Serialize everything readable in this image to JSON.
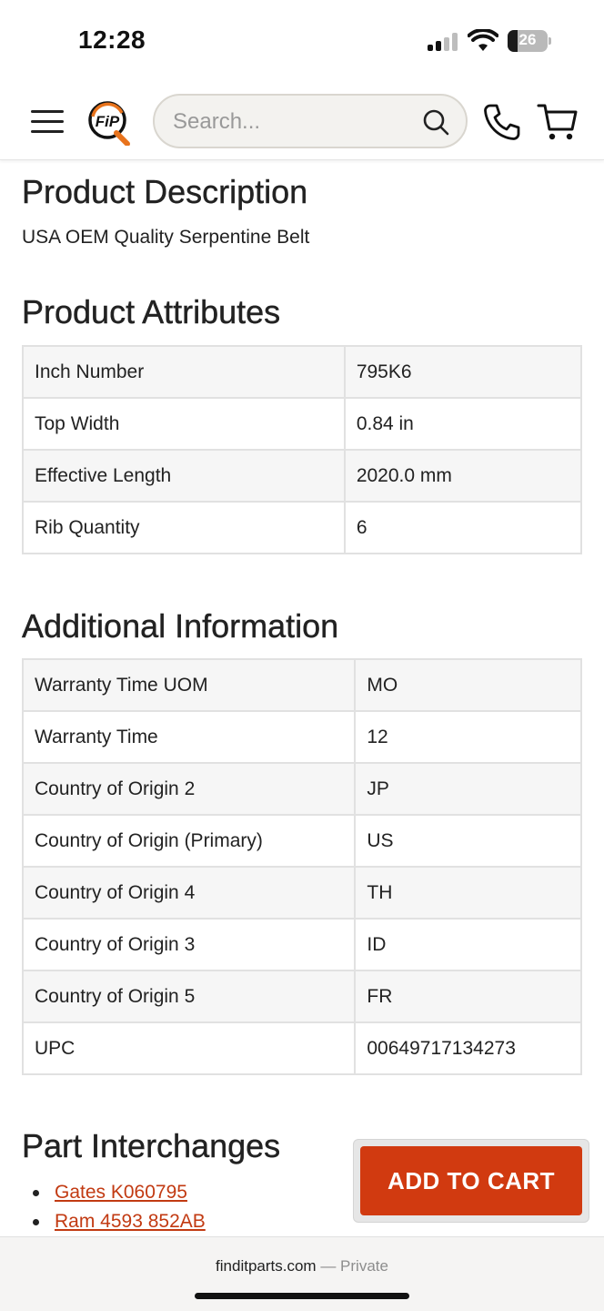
{
  "status_bar": {
    "time": "12:28",
    "battery": "26",
    "battery_level": 0.26
  },
  "header": {
    "logo_text": "FiP",
    "search_placeholder": "Search..."
  },
  "description": {
    "title": "Product Description",
    "text": "USA OEM Quality Serpentine Belt"
  },
  "attributes": {
    "title": "Product Attributes",
    "rows": [
      {
        "label": "Inch Number",
        "value": "795K6"
      },
      {
        "label": "Top Width",
        "value": "0.84 in"
      },
      {
        "label": "Effective Length",
        "value": "2020.0 mm"
      },
      {
        "label": "Rib Quantity",
        "value": "6"
      }
    ]
  },
  "additional": {
    "title": "Additional Information",
    "rows": [
      {
        "label": "Warranty Time UOM",
        "value": "MO"
      },
      {
        "label": "Warranty Time",
        "value": "12"
      },
      {
        "label": "Country of Origin 2",
        "value": "JP"
      },
      {
        "label": "Country of Origin (Primary)",
        "value": "US"
      },
      {
        "label": "Country of Origin 4",
        "value": "TH"
      },
      {
        "label": "Country of Origin 3",
        "value": "ID"
      },
      {
        "label": "Country of Origin 5",
        "value": "FR"
      },
      {
        "label": "UPC",
        "value": "00649717134273"
      }
    ]
  },
  "interchanges": {
    "title": "Part Interchanges",
    "items": [
      "Gates K060795",
      "Ram 4593 852AB"
    ]
  },
  "cta": {
    "add_to_cart": "ADD TO CART"
  },
  "browser": {
    "domain": "finditparts.com",
    "separator": "—",
    "mode": "Private"
  },
  "colors": {
    "accent": "#d13a10",
    "link": "#c23a12",
    "logo_orange": "#e8731c"
  }
}
